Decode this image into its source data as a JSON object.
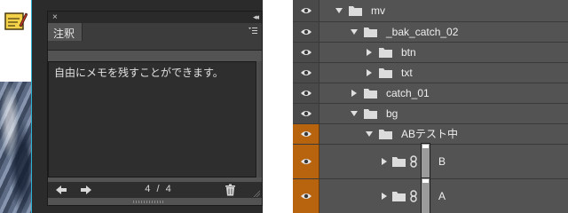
{
  "notes_panel": {
    "close_glyph": "×",
    "collapse_glyph": "◂◂",
    "tab_label": "注釈",
    "note_text": "自由にメモを残すことができます。",
    "counter": "4 / 4",
    "icons": [
      "close-icon",
      "collapse-icon",
      "panel-menu-icon",
      "previous-note-icon",
      "next-note-icon",
      "trash-icon",
      "resize-grip-icon"
    ]
  },
  "layers_panel": {
    "rows": [
      {
        "name": "mv",
        "type": "group",
        "expanded": true,
        "eye_highlight": false
      },
      {
        "name": "_bak_catch_02",
        "type": "group",
        "expanded": true,
        "eye_highlight": false
      },
      {
        "name": "btn",
        "type": "group",
        "expanded": false,
        "eye_highlight": false
      },
      {
        "name": "txt",
        "type": "group",
        "expanded": false,
        "eye_highlight": false
      },
      {
        "name": "catch_01",
        "type": "group",
        "expanded": false,
        "eye_highlight": false
      },
      {
        "name": "bg",
        "type": "group",
        "expanded": true,
        "eye_highlight": false
      },
      {
        "name": "ABテスト中",
        "type": "group",
        "expanded": true,
        "eye_highlight": true
      },
      {
        "name": "B",
        "type": "group-with-mask",
        "expanded": false,
        "eye_highlight": true
      },
      {
        "name": "A",
        "type": "group-with-mask",
        "expanded": false,
        "eye_highlight": true
      }
    ]
  },
  "colors": {
    "panel_bg": "#535353",
    "dark_bg": "#2b2b2b",
    "eye_highlight": "#b8640f",
    "canvas_edge": "#2fb4d6"
  }
}
